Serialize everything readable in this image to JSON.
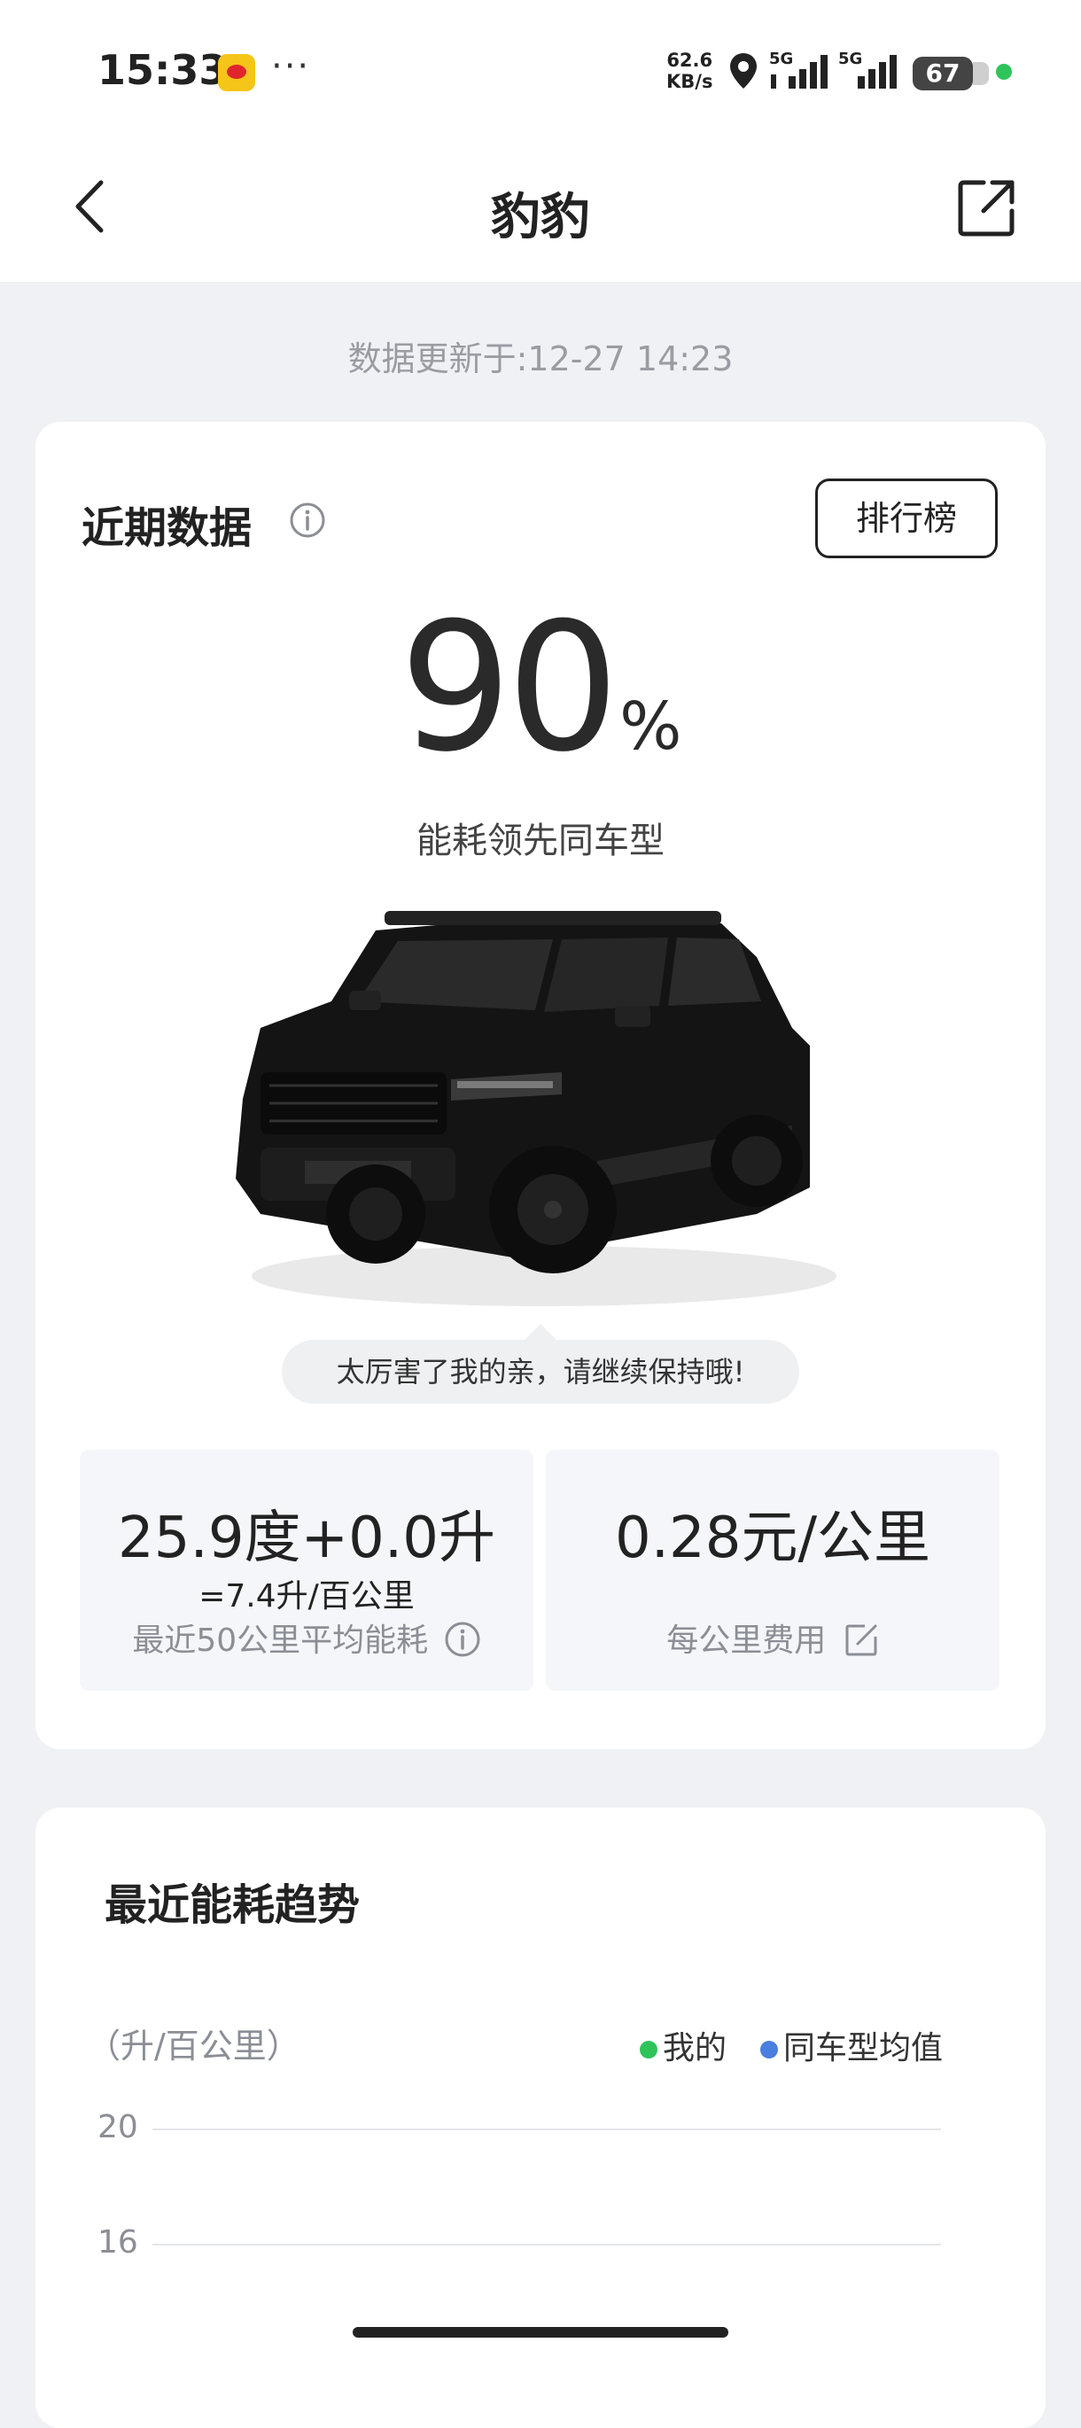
{
  "status_bar": {
    "time": "15:33",
    "dots": "···",
    "net_speed_value": "62.6",
    "net_speed_unit": "KB/s",
    "signal1": "5G",
    "signal2": "5G",
    "battery": "67"
  },
  "header": {
    "title": "豹豹"
  },
  "update_text": "数据更新于:12-27 14:23",
  "recent": {
    "title": "近期数据",
    "rank_label": "排行榜",
    "percent": "90",
    "percent_unit": "%",
    "percent_label": "能耗领先同车型",
    "bubble": "太厉害了我的亲，请继续保持哦!",
    "energy_value": "25.9度+0.0升",
    "energy_equiv": "=7.4升/百公里",
    "energy_caption": "最近50公里平均能耗",
    "cost_value": "0.28元/公里",
    "cost_caption": "每公里费用"
  },
  "trend": {
    "title": "最近能耗趋势",
    "unit_label": "（升/百公里）",
    "legend_mine": "我的",
    "legend_avg": "同车型均值",
    "mine_color": "#2ec45a",
    "avg_color": "#4a7fe0"
  },
  "chart_data": {
    "type": "line",
    "ylabel": "（升/百公里）",
    "yticks": [
      20,
      16
    ],
    "series": [
      {
        "name": "我的",
        "values": []
      },
      {
        "name": "同车型均值",
        "values": []
      }
    ]
  }
}
